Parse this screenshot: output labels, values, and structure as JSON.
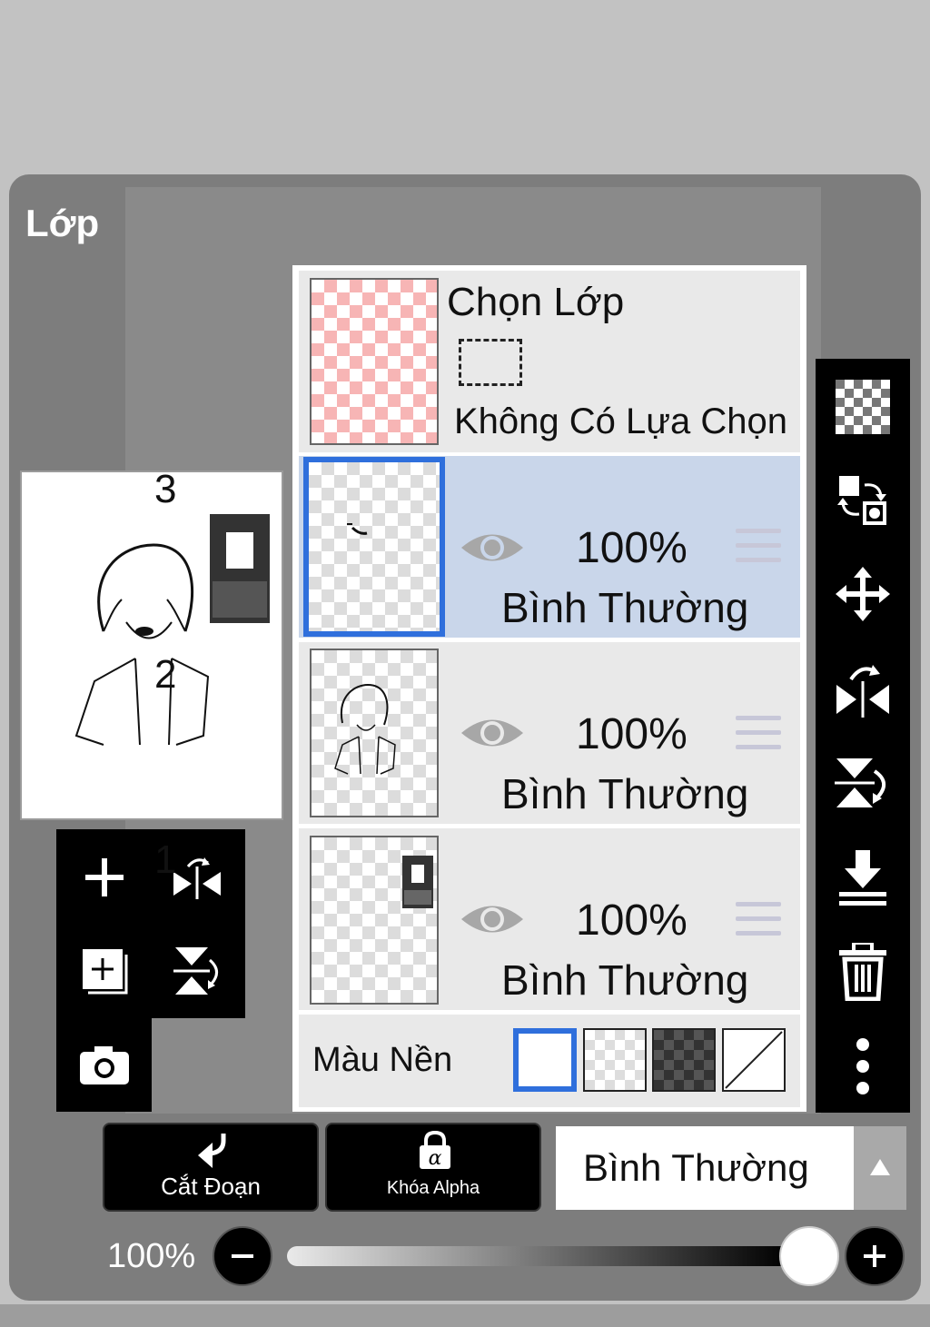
{
  "panel": {
    "title": "Lớp"
  },
  "selection_layer": {
    "title": "Chọn Lớp",
    "status": "Không Có Lựa Chọn"
  },
  "layers": [
    {
      "number": "3",
      "opacity": "100%",
      "blend": "Bình Thường",
      "selected": true
    },
    {
      "number": "2",
      "opacity": "100%",
      "blend": "Bình Thường",
      "selected": false
    },
    {
      "number": "1",
      "opacity": "100%",
      "blend": "Bình Thường",
      "selected": false
    }
  ],
  "background_row": {
    "label": "Màu Nền",
    "options": [
      "white",
      "transparent-light",
      "transparent-dark",
      "none"
    ],
    "selected": "white"
  },
  "left_tools": [
    "add-layer-icon",
    "flip-horizontal-icon",
    "add-copy-layer-icon",
    "flip-vertical-icon",
    "camera-icon"
  ],
  "right_tools": [
    "transparency-icon",
    "swap-layers-icon",
    "move-icon",
    "flip-horizontal-rotate-icon",
    "flip-vertical-rotate-icon",
    "merge-down-icon",
    "trash-icon",
    "more-icon"
  ],
  "bottom": {
    "clip_label": "Cắt Đoạn",
    "alpha_lock_label": "Khóa Alpha",
    "blend_mode": "Bình Thường",
    "opacity_label": "100%",
    "opacity_value": 1.0
  },
  "colors": {
    "accent": "#2f6fdc",
    "selected_row": "#c9d6ea",
    "panel": "#7d7d7d"
  }
}
